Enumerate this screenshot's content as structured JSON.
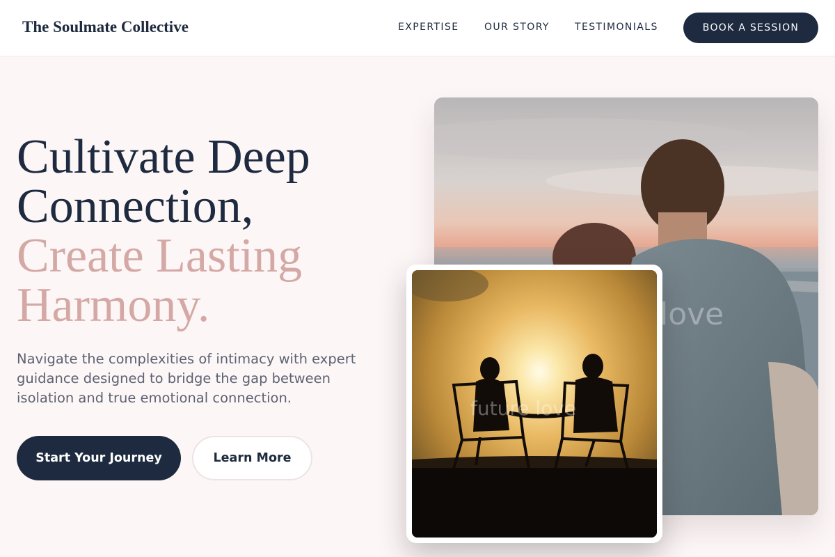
{
  "nav": {
    "brand": "The Soulmate Collective",
    "links": [
      "EXPERTISE",
      "OUR STORY",
      "TESTIMONIALS"
    ],
    "cta": "BOOK A SESSION"
  },
  "hero": {
    "title_dark": [
      "Cultivate Deep",
      "Connection,"
    ],
    "title_accent": [
      "Create Lasting",
      "Harmony."
    ],
    "subtitle": "Navigate the complexities of intimacy with expert guidance designed to bridge the gap between isolation and true emotional connection.",
    "primary_button": "Start Your Journey",
    "secondary_button": "Learn More"
  },
  "images": {
    "main_watermark": "love",
    "secondary_watermark": "future love"
  },
  "colors": {
    "navy": "#1e2a3f",
    "accent_pink": "#d4a9a5",
    "background": "#fdf6f6"
  }
}
